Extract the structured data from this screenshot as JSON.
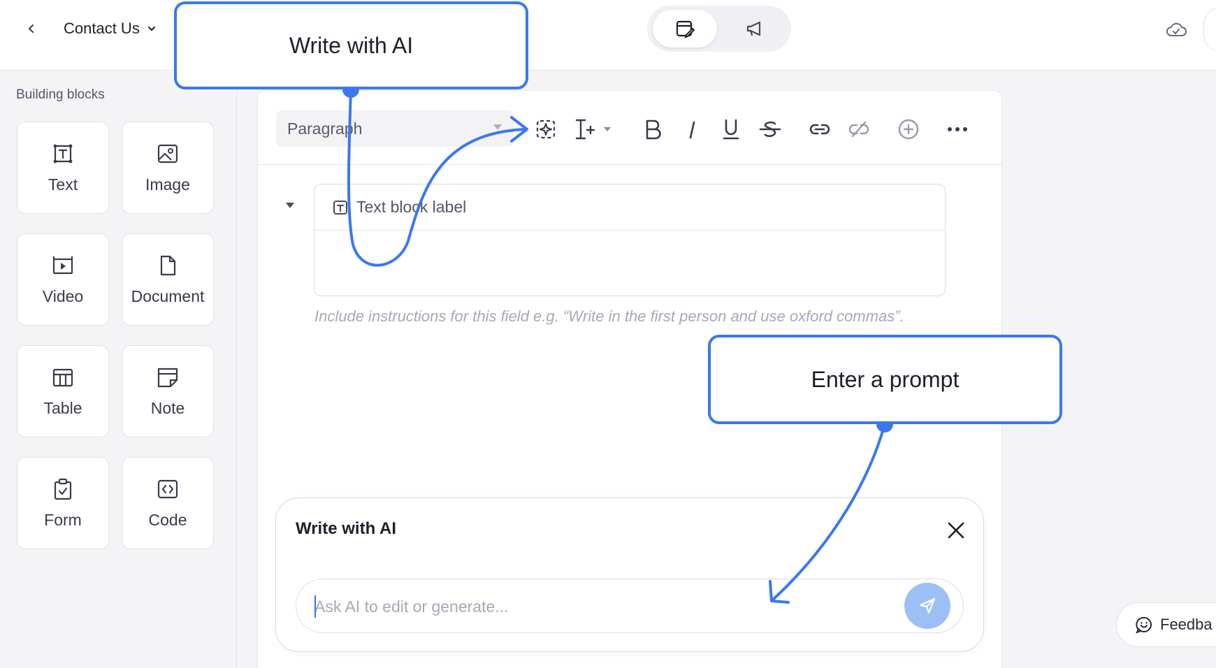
{
  "header": {
    "doc_title": "Contact Us",
    "icons": {
      "back": "chevron-left-icon",
      "title_dropdown": "chevron-down-icon",
      "edit_mode": "edit-document-icon",
      "publish_mode": "megaphone-icon",
      "sync": "cloud-check-icon"
    }
  },
  "sidebar": {
    "title": "Building blocks",
    "blocks": [
      {
        "label": "Text",
        "icon": "text-block-icon"
      },
      {
        "label": "Image",
        "icon": "image-icon"
      },
      {
        "label": "Video",
        "icon": "video-icon"
      },
      {
        "label": "Document",
        "icon": "document-icon"
      },
      {
        "label": "Table",
        "icon": "table-icon"
      },
      {
        "label": "Note",
        "icon": "note-icon"
      },
      {
        "label": "Form",
        "icon": "form-clipboard-icon"
      },
      {
        "label": "Code",
        "icon": "code-icon"
      }
    ]
  },
  "toolbar": {
    "paragraph_style": "Paragraph",
    "tools": [
      "ai-sparkle-icon",
      "text-insert-icon",
      "bold-icon",
      "italic-icon",
      "underline-icon",
      "strikethrough-icon",
      "link-icon",
      "unlink-icon",
      "add-circle-icon",
      "more-icon"
    ]
  },
  "text_block": {
    "label": "Text block label",
    "hint": "Include instructions for this field e.g. “Write in the first person and use oxford commas”."
  },
  "ai_panel": {
    "title": "Write with AI",
    "placeholder": "Ask AI to edit or generate..."
  },
  "feedback": {
    "label": "Feedba"
  },
  "annotations": {
    "callout_1": "Write with AI",
    "callout_2": "Enter a prompt",
    "accent_color": "#3b78f0"
  }
}
